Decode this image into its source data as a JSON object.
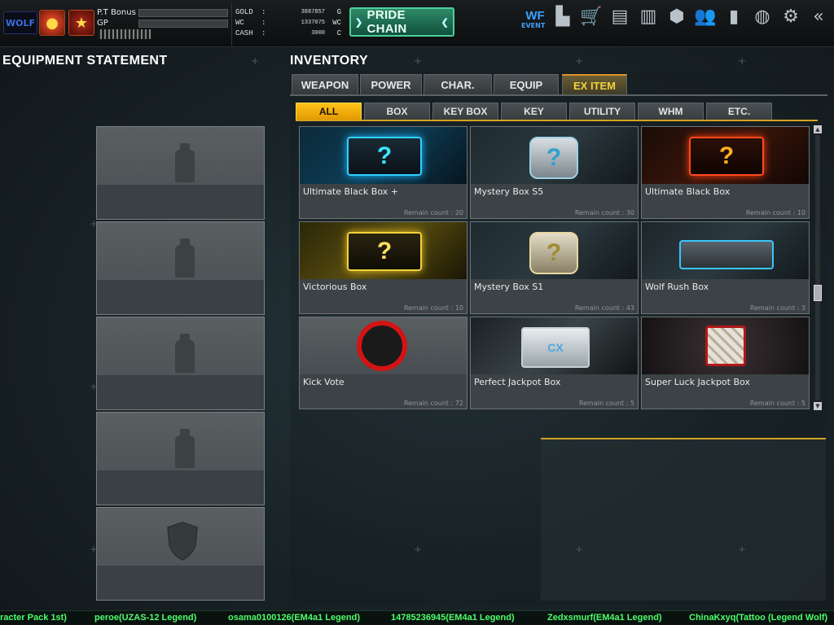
{
  "topbar": {
    "logo_text": "WOLF",
    "pt_bonus_label": "P.T Bonus",
    "gp_label": "GP",
    "pride_chain_label": "PRIDE CHAIN",
    "event_label": "EVENT",
    "currencies": [
      {
        "name": "GOLD",
        "value": "3887857",
        "unit": "G"
      },
      {
        "name": "WC",
        "value": "1337075",
        "unit": "WC"
      },
      {
        "name": "CASH",
        "value": "3000",
        "unit": "C"
      }
    ],
    "icons": [
      "event-icon",
      "ranking-icon",
      "shop-icon",
      "toolbox-icon",
      "locker-icon",
      "box-icon",
      "friends-icon",
      "stats-icon",
      "globe-icon",
      "settings-icon",
      "back-icon"
    ]
  },
  "equipment": {
    "title": "EQUIPMENT STATEMENT",
    "slots": [
      "spray-slot-1",
      "spray-slot-2",
      "spray-slot-3",
      "spray-slot-4",
      "shield-slot"
    ]
  },
  "inventory": {
    "title": "INVENTORY",
    "categories": [
      "WEAPON",
      "POWER",
      "CHAR.",
      "EQUIP",
      "EX ITEM"
    ],
    "active_category": "EX ITEM",
    "subtabs": [
      "ALL",
      "BOX",
      "KEY BOX",
      "KEY",
      "UTILITY",
      "WHM",
      "ETC."
    ],
    "active_subtab": "ALL",
    "items": [
      {
        "name": "Ultimate Black Box +",
        "remain": "Remain count : 20"
      },
      {
        "name": "Mystery Box S5",
        "remain": "Remain count : 30"
      },
      {
        "name": "Ultimate Black Box",
        "remain": "Remain count : 10"
      },
      {
        "name": "Victorious Box",
        "remain": "Remain count : 10"
      },
      {
        "name": "Mystery Box S1",
        "remain": "Remain count : 43"
      },
      {
        "name": "Wolf Rush Box",
        "remain": "Remain count : 3"
      },
      {
        "name": "Kick Vote",
        "remain": "Remain count : 72"
      },
      {
        "name": "Perfect Jackpot Box",
        "remain": "Remain count : 5"
      },
      {
        "name": "Super Luck Jackpot Box",
        "remain": "Remain count : 5"
      }
    ]
  },
  "ticker": [
    "racter Pack 1st)",
    "peroe(UZAS-12 Legend)",
    "osama0100126(EM4a1 Legend)",
    "14785236945(EM4a1 Legend)",
    "Zedxsmurf(EM4a1 Legend)",
    "ChinaKxyq(Tattoo (Legend Wolf)"
  ]
}
